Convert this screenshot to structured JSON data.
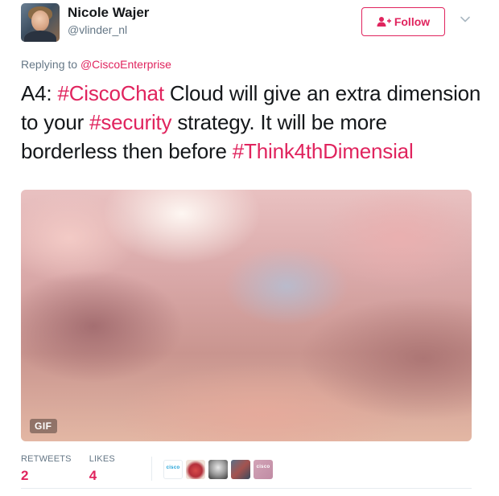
{
  "author": {
    "name": "Nicole Wajer",
    "handle": "@vlinder_nl"
  },
  "follow_button": {
    "label": "Follow"
  },
  "reply": {
    "prefix": "Replying to ",
    "mention": "@CiscoEnterprise"
  },
  "tweet": {
    "segments": [
      {
        "text": "A4: ",
        "type": "text"
      },
      {
        "text": "#CiscoChat",
        "type": "hashtag"
      },
      {
        "text": " Cloud will give an extra dimension to your ",
        "type": "text"
      },
      {
        "text": "#security",
        "type": "hashtag"
      },
      {
        "text": " strategy. It will be more borderless then before ",
        "type": "text"
      },
      {
        "text": "#Think4thDimensial",
        "type": "hashtag"
      }
    ]
  },
  "media": {
    "badge": "GIF"
  },
  "stats": {
    "retweets_label": "RETWEETS",
    "retweets_value": "2",
    "likes_label": "LIKES",
    "likes_value": "4"
  },
  "likers": [
    {
      "icon": "cisco-logo-avatar",
      "mark": "cisco"
    },
    {
      "icon": "cake-avatar"
    },
    {
      "icon": "person-avatar"
    },
    {
      "icon": "group-avatar"
    },
    {
      "icon": "cisco-logo-avatar",
      "mark": "cisco"
    }
  ],
  "colors": {
    "accent": "#e0245e",
    "text": "#14171a",
    "muted": "#657786"
  }
}
